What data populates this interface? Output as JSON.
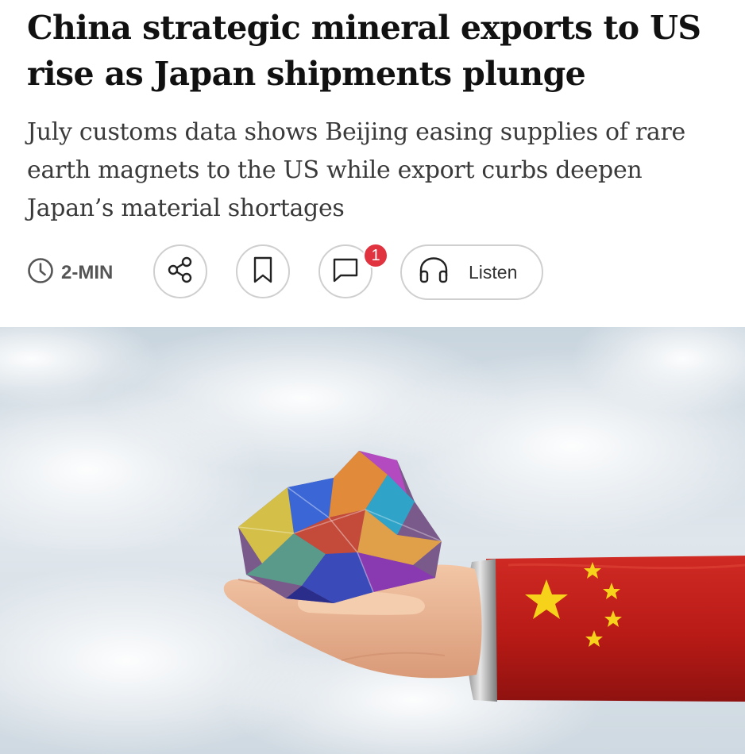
{
  "article": {
    "headline": "China strategic mineral exports to US rise as Japan shipments plunge",
    "subheadline": "July customs data shows Beijing easing supplies of rare earth magnets to the US while export curbs deepen Japan’s material shortages"
  },
  "toolbar": {
    "read_time": "2-MIN",
    "comment_count": "1",
    "listen_label": "Listen",
    "icons": [
      "clock-icon",
      "share-icon",
      "bookmark-icon",
      "comment-icon",
      "headphones-icon"
    ]
  },
  "colors": {
    "badge": "#e0323f",
    "button_border": "#cfcfcf",
    "flag_red": "#c8201c",
    "star_yellow": "#f6d21a"
  }
}
